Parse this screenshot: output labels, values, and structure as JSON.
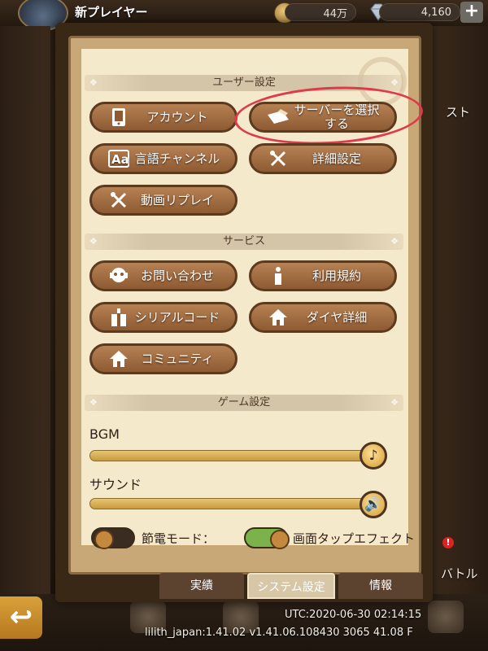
{
  "topbar": {
    "player_name": "新プレイヤー",
    "coins": "44万",
    "gems": "4,160",
    "plus": "+"
  },
  "side": {
    "right_label_1": "スト",
    "right_label_2": "バトル",
    "notif": "!"
  },
  "sections": {
    "user": "ユーザー設定",
    "service": "サービス",
    "game": "ゲーム設定"
  },
  "buttons": {
    "account": "アカウント",
    "select_server": "サーバーを選択\nする",
    "language": "言語チャンネル",
    "advanced": "詳細設定",
    "replay": "動画リプレイ",
    "contact": "お問い合わせ",
    "terms": "利用規約",
    "serial": "シリアルコード",
    "diamond": "ダイヤ詳細",
    "community": "コミュニティ"
  },
  "sliders": {
    "bgm_label": "BGM",
    "bgm_level": 1.0,
    "sound_label": "サウンド",
    "sound_level": 1.0
  },
  "toggles": {
    "power_label": "節電モード：",
    "power_on": false,
    "tap_label": "画面タップエフェクト",
    "tap_on": true
  },
  "tabs": {
    "achievements": "実績",
    "system": "システム設定",
    "info": "情報"
  },
  "footer": {
    "utc": "UTC:2020-06-30 02:14:15",
    "build": "lilith_japan:1.41.02  v1.41.06.108430 3065 41.08 F"
  },
  "colors": {
    "button": "#a06d42",
    "highlight": "#e0394b",
    "panel": "#f5e9cb"
  }
}
